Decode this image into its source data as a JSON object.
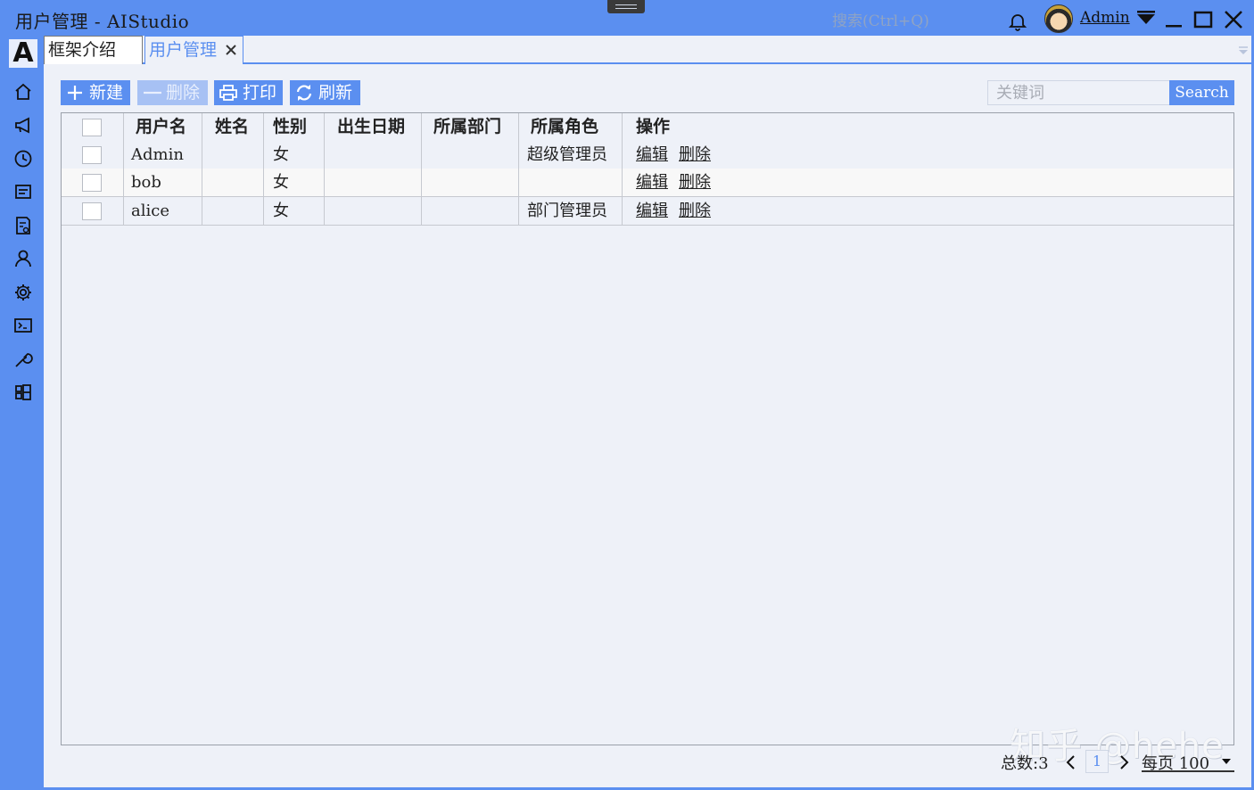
{
  "window": {
    "title": "用户管理 - AIStudio",
    "search_placeholder": "搜索(Ctrl+Q)",
    "user": "Admin"
  },
  "sidebar": {
    "logo": "A",
    "icons": [
      "home-icon",
      "megaphone-icon",
      "clock-icon",
      "message-icon",
      "document-icon",
      "user-icon",
      "gear-icon",
      "terminal-icon",
      "wrench-icon",
      "apps-icon"
    ]
  },
  "tabs": [
    {
      "label": "框架介绍",
      "active": false
    },
    {
      "label": "用户管理",
      "active": true
    }
  ],
  "toolbar": {
    "new_label": "新建",
    "delete_label": "删除",
    "print_label": "打印",
    "refresh_label": "刷新",
    "keyword_placeholder": "关键词",
    "search_label": "Search"
  },
  "table": {
    "columns": [
      "用户名",
      "姓名",
      "性别",
      "出生日期",
      "所属部门",
      "所属角色",
      "操作"
    ],
    "rows": [
      {
        "username": "Admin",
        "name": "",
        "sex": "女",
        "birth": "",
        "dept": "",
        "role": "超级管理员"
      },
      {
        "username": "bob",
        "name": "",
        "sex": "女",
        "birth": "",
        "dept": "",
        "role": ""
      },
      {
        "username": "alice",
        "name": "",
        "sex": "女",
        "birth": "",
        "dept": "",
        "role": "部门管理员"
      }
    ],
    "actions": {
      "edit": "编辑",
      "delete": "删除"
    }
  },
  "pager": {
    "total_label": "总数:3",
    "current_page": "1",
    "page_size_label": "每页 100"
  },
  "watermark": "知乎 @hehe",
  "colors": {
    "accent": "#5b8ff0",
    "background": "#eef1f8",
    "disabled": "#a7c1f4"
  }
}
